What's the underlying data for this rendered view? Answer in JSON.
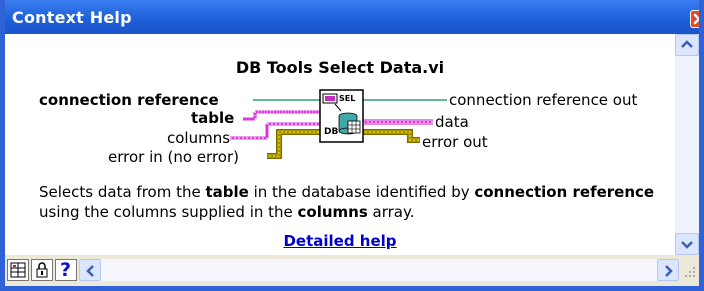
{
  "window": {
    "title": "Context Help"
  },
  "vi": {
    "name": "DB Tools Select Data.vi",
    "icon_text_top": "SEL",
    "icon_text_bottom": "DB",
    "inputs": [
      "connection reference",
      "table",
      "columns",
      "error in (no error)"
    ],
    "outputs": [
      "connection reference out",
      "data",
      "error out"
    ]
  },
  "description": {
    "p1": "Selects data from the ",
    "b1": "table",
    "p2": " in the database identified by ",
    "b2": "connection reference",
    "p3": " using the columns supplied in the ",
    "b3": "columns",
    "p4": " array."
  },
  "links": {
    "detailed_help": "Detailed help"
  },
  "toolbar": {
    "help_glyph": "?"
  },
  "colors": {
    "title_bar": "#2563d9",
    "link": "#0000cc",
    "wire_ref": "#2aa37d",
    "wire_string": "#d63bd6",
    "wire_error": "#c8b400"
  }
}
